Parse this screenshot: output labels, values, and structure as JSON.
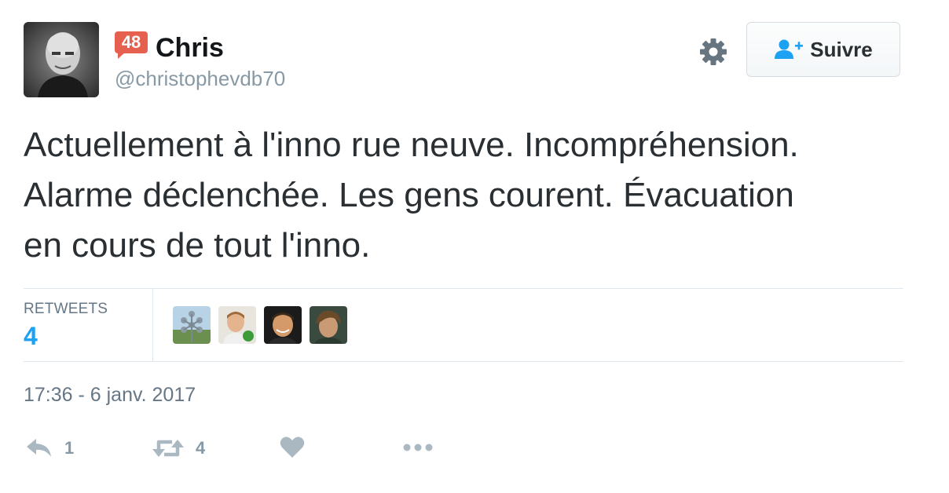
{
  "user": {
    "badge": "48",
    "display_name": "Chris",
    "handle": "@christophevdb70"
  },
  "header": {
    "settings_icon": "gear-icon",
    "follow_label": "Suivre",
    "follow_icon": "user-plus-icon",
    "follow_icon_color": "#1da1f2"
  },
  "tweet": {
    "text": "Actuellement à l'inno rue neuve. Incompréhension.\nAlarme déclenchée. Les gens courent. Évacuation\nen cours de tout l'inno."
  },
  "stats": {
    "retweets_label": "RETWEETS",
    "retweets_count": "4",
    "retweeter_avatars": [
      "retweeter-1",
      "retweeter-2",
      "retweeter-3",
      "retweeter-4"
    ]
  },
  "timestamp": "17:36 - 6 janv. 2017",
  "actions": {
    "reply_count": "1",
    "retweet_count": "4",
    "like_icon": "heart-icon",
    "more_icon": "more-dots-icon"
  },
  "colors": {
    "accent": "#1da1f2",
    "badge": "#e5604e",
    "muted": "#8899a6"
  }
}
